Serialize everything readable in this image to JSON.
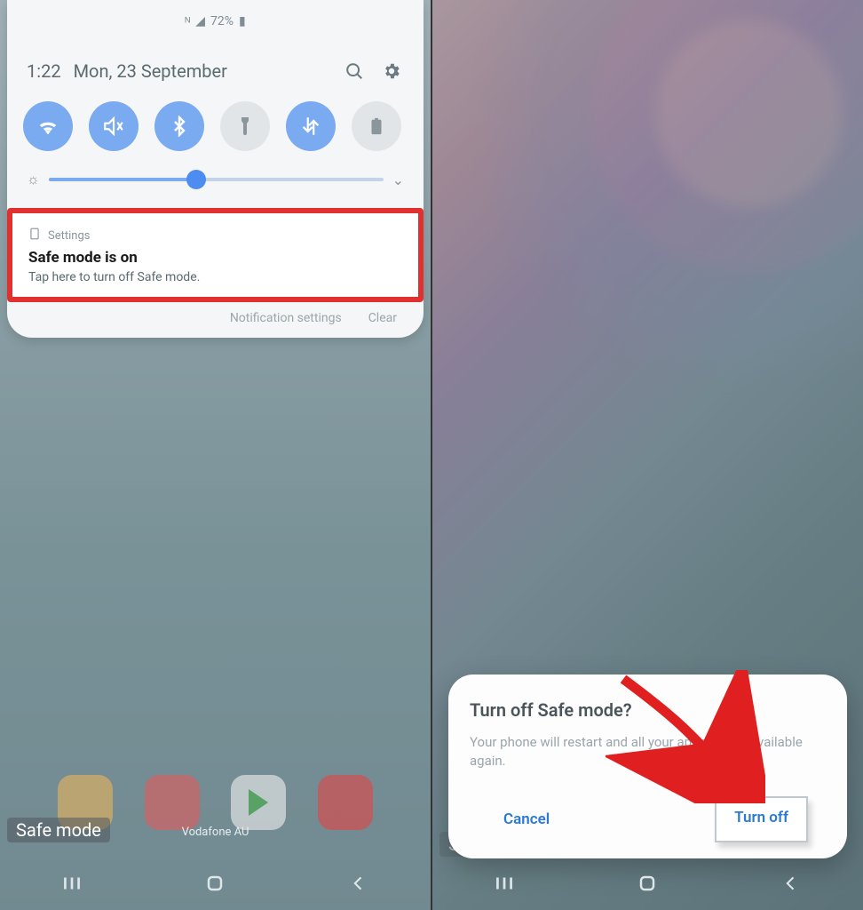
{
  "status": {
    "battery_text": "72%",
    "icons_label": "NFC"
  },
  "shade": {
    "time": "1:22",
    "date": "Mon, 23 September",
    "quick_settings": [
      {
        "name": "wifi",
        "on": true
      },
      {
        "name": "mute",
        "on": true
      },
      {
        "name": "bluetooth",
        "on": true
      },
      {
        "name": "flashlight",
        "on": false
      },
      {
        "name": "data",
        "on": true
      },
      {
        "name": "battery",
        "on": false
      }
    ],
    "notification": {
      "app": "Settings",
      "title": "Safe mode is on",
      "body": "Tap here to turn off Safe mode."
    },
    "actions": {
      "settings": "Notification settings",
      "clear": "Clear"
    }
  },
  "home": {
    "safe_mode_label": "Safe mode",
    "carrier": "Vodafone AU"
  },
  "dialog": {
    "title": "Turn off Safe mode?",
    "body": "Your phone will restart and all your apps will be available again.",
    "cancel": "Cancel",
    "confirm": "Turn off"
  }
}
